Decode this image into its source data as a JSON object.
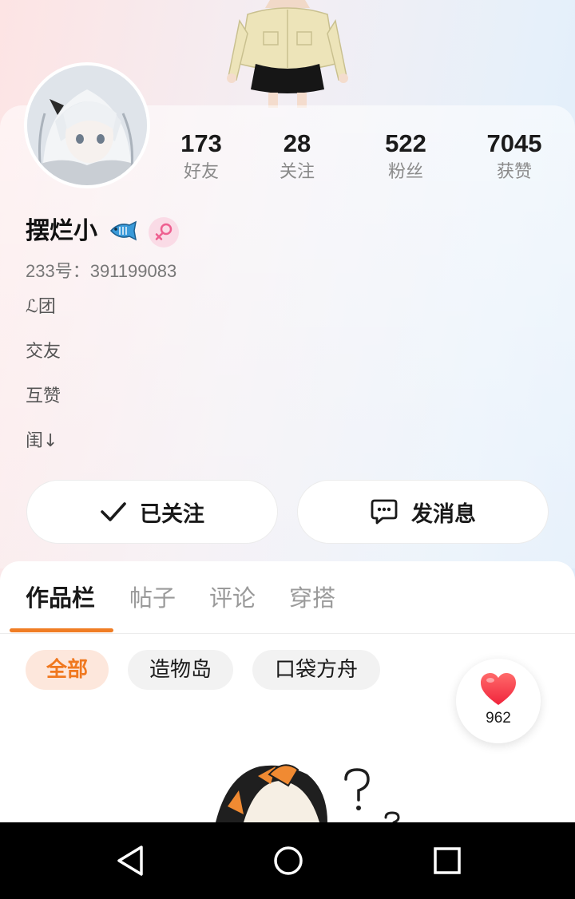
{
  "profile": {
    "name": "摆烂小",
    "uid_text": "233号：391199083",
    "bio": [
      "ℒ团",
      "交友",
      "互赞",
      "闺↓"
    ]
  },
  "stats": [
    {
      "value": "173",
      "label": "好友"
    },
    {
      "value": "28",
      "label": "关注"
    },
    {
      "value": "522",
      "label": "粉丝"
    },
    {
      "value": "7045",
      "label": "获赞"
    }
  ],
  "actions": {
    "follow_label": "已关注",
    "message_label": "发消息"
  },
  "tabs": [
    {
      "label": "作品栏",
      "active": true
    },
    {
      "label": "帖子"
    },
    {
      "label": "评论"
    },
    {
      "label": "穿搭"
    }
  ],
  "filters": [
    {
      "label": "全部",
      "active": true
    },
    {
      "label": "造物岛"
    },
    {
      "label": "口袋方舟"
    }
  ],
  "like_fab": {
    "count": "962",
    "icon": "heart-icon"
  },
  "colors": {
    "accent": "#f07d24",
    "chip_active_bg": "#fde7dc",
    "gender_badge_bg": "#fadbe6"
  },
  "icons": {
    "badge": "fish-badge-icon",
    "gender": "female-icon",
    "follow": "check-icon",
    "message": "chat-bubble-icon",
    "nav": [
      "back-icon",
      "home-icon",
      "recents-icon"
    ]
  }
}
